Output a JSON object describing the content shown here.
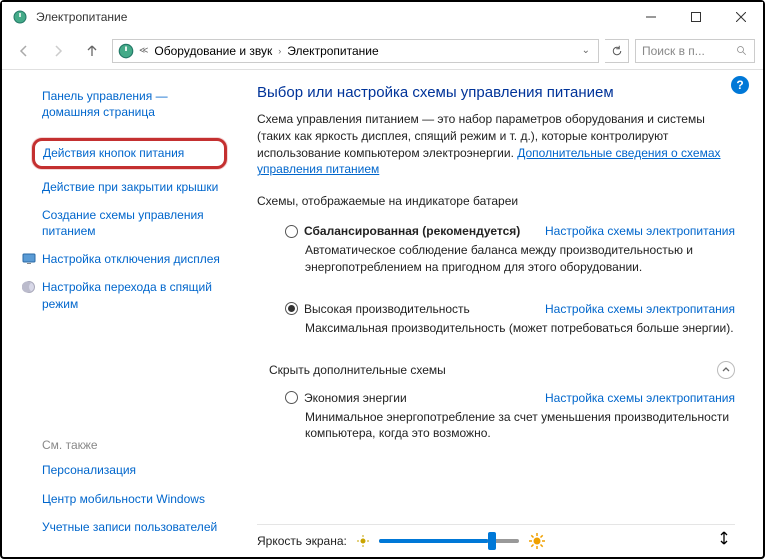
{
  "window": {
    "title": "Электропитание"
  },
  "breadcrumb": {
    "cat": "Оборудование и звук",
    "page": "Электропитание"
  },
  "search": {
    "placeholder": "Поиск в п..."
  },
  "sidebar": {
    "home": "Панель управления — домашняя страница",
    "items": [
      "Действия кнопок питания",
      "Действие при закрытии крышки",
      "Создание схемы управления питанием",
      "Настройка отключения дисплея",
      "Настройка перехода в спящий режим"
    ],
    "see_also_hdr": "См. также",
    "see_also": [
      "Персонализация",
      "Центр мобильности Windows",
      "Учетные записи пользователей"
    ]
  },
  "main": {
    "heading": "Выбор или настройка схемы управления питанием",
    "desc": "Схема управления питанием — это набор параметров оборудования и системы (таких как яркость дисплея, спящий режим и т. д.), которые контролируют использование компьютером электроэнергии. ",
    "desc_link": "Дополнительные сведения о схемах управления питанием",
    "section1": "Схемы, отображаемые на индикаторе батареи",
    "plans": [
      {
        "name": "Сбалансированная (рекомендуется)",
        "bold": true,
        "checked": false,
        "link": "Настройка схемы электропитания",
        "desc": "Автоматическое соблюдение баланса между производительностью и энергопотреблением на пригодном для этого оборудовании."
      },
      {
        "name": "Высокая производительность",
        "bold": false,
        "checked": true,
        "link": "Настройка схемы электропитания",
        "desc": "Максимальная производительность (может потребоваться больше энергии)."
      }
    ],
    "section2": "Скрыть дополнительные схемы",
    "plans2": [
      {
        "name": "Экономия энергии",
        "bold": false,
        "checked": false,
        "link": "Настройка схемы электропитания",
        "desc": "Минимальное энергопотребление за счет уменьшения производительности компьютера, когда это возможно."
      }
    ],
    "brightness_label": "Яркость экрана:"
  }
}
